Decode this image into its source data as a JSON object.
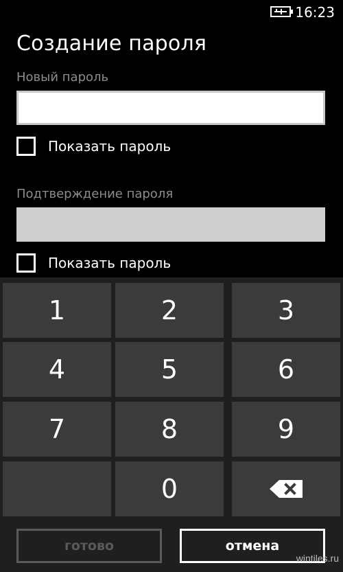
{
  "status_bar": {
    "time": "16:23",
    "battery_icon": "battery-charging-icon"
  },
  "page": {
    "title": "Создание пароля"
  },
  "new_password": {
    "label": "Новый пароль",
    "value": "",
    "show_password_label": "Показать пароль",
    "show_password_checked": false
  },
  "confirm_password": {
    "label": "Подтверждение пароля",
    "value": "",
    "show_password_label": "Показать пароль",
    "show_password_checked": false
  },
  "keypad": {
    "keys": [
      "1",
      "2",
      "3",
      "4",
      "5",
      "6",
      "7",
      "8",
      "9",
      "",
      "0",
      "⌫"
    ],
    "backspace_icon": "backspace-icon"
  },
  "actions": {
    "done_label": "готово",
    "cancel_label": "отмена"
  },
  "watermark": "wintiles.ru",
  "colors": {
    "background": "#000000",
    "key": "#3b3b3b",
    "label_gray": "#8c8c8c",
    "disabled": "#5a5a5a"
  }
}
